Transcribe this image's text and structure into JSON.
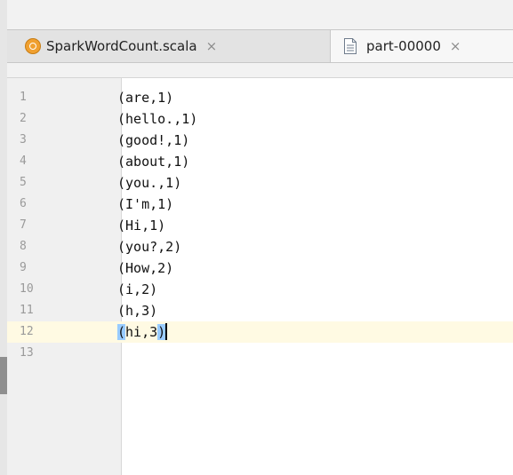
{
  "tabs": [
    {
      "label": "SparkWordCount.scala",
      "icon": "scala-file-icon",
      "close": "×",
      "active": false
    },
    {
      "label": "part-00000",
      "icon": "text-file-icon",
      "close": "×",
      "active": true
    }
  ],
  "editor": {
    "current_line": 12,
    "lines": [
      {
        "num": "1",
        "text": "(are,1)"
      },
      {
        "num": "2",
        "text": "(hello.,1)"
      },
      {
        "num": "3",
        "text": "(good!,1)"
      },
      {
        "num": "4",
        "text": "(about,1)"
      },
      {
        "num": "5",
        "text": "(you.,1)"
      },
      {
        "num": "6",
        "text": "(I'm,1)"
      },
      {
        "num": "7",
        "text": "(Hi,1)"
      },
      {
        "num": "8",
        "text": "(you?,2)"
      },
      {
        "num": "9",
        "text": "(How,2)"
      },
      {
        "num": "10",
        "text": "(i,2)"
      },
      {
        "num": "11",
        "text": "(h,3)"
      },
      {
        "num": "12",
        "open": "(",
        "middle": "hi,3",
        "close": ")"
      },
      {
        "num": "13",
        "text": ""
      }
    ]
  },
  "colors": {
    "current_line": "#fffae3",
    "bracket_match": "#99ccff",
    "gutter": "#f0f0f0"
  }
}
